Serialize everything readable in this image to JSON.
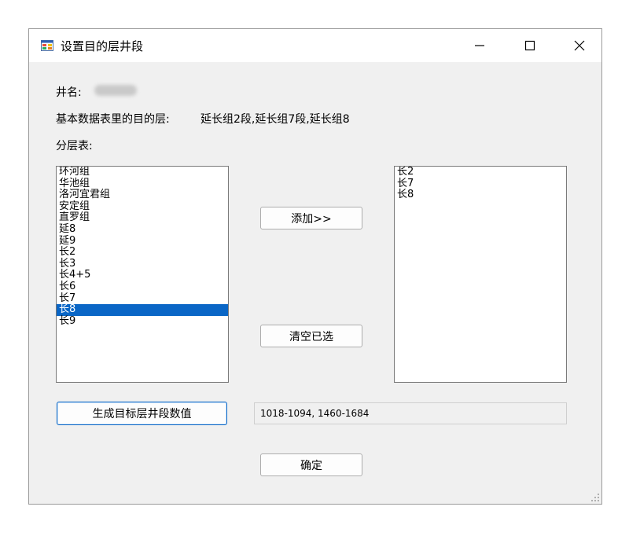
{
  "window": {
    "title": "设置目的层井段",
    "icon": "app-window-icon",
    "controls": [
      "minimize-icon",
      "maximize-icon",
      "close-icon"
    ]
  },
  "form": {
    "well_name_label": "井名:",
    "target_layers_label": "基本数据表里的目的层:",
    "target_layers_value": "延长组2段,延长组7段,延长组8",
    "layer_table_label": "分层表:"
  },
  "left_list": {
    "items": [
      "环河组",
      "华池组",
      "洛河宜君组",
      "安定组",
      "直罗组",
      "延8",
      "延9",
      "长2",
      "长3",
      "长4+5",
      "长6",
      "长7",
      "长8",
      "长9"
    ],
    "selected_index": 12
  },
  "right_list": {
    "items": [
      "长2",
      "长7",
      "长8"
    ]
  },
  "buttons": {
    "add": "添加>>",
    "clear": "清空已选",
    "generate": "生成目标层井段数值",
    "ok": "确定"
  },
  "result": {
    "value": "1018-1094, 1460-1684"
  },
  "colors": {
    "selection": "#0a66c6",
    "window_bg": "#f0f0f0"
  }
}
